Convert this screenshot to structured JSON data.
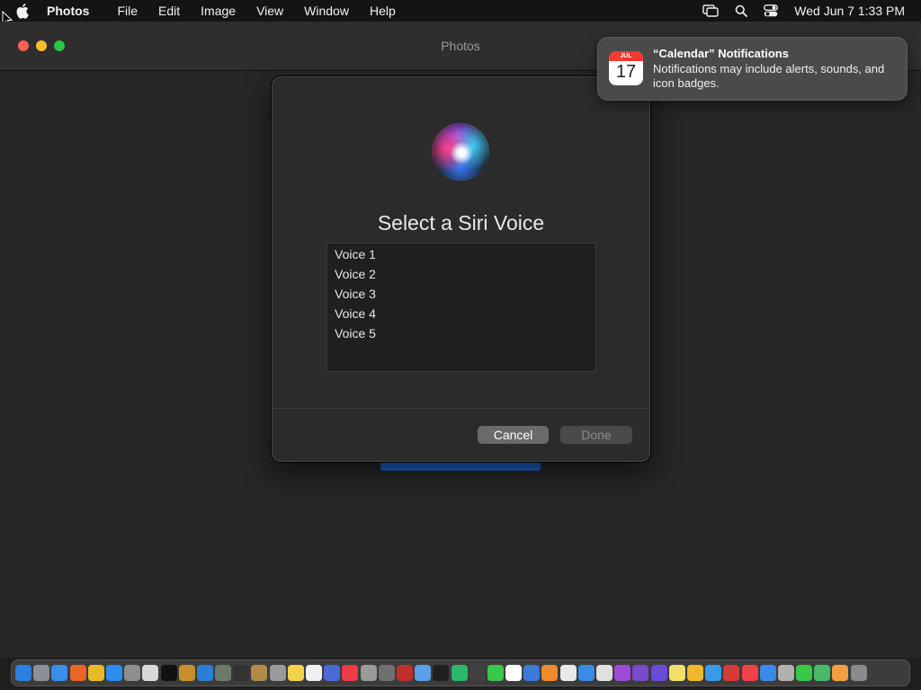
{
  "menubar": {
    "app_name": "Photos",
    "items": [
      "File",
      "Edit",
      "Image",
      "View",
      "Window",
      "Help"
    ],
    "clock": "Wed Jun 7  1:33 PM",
    "status_icons": [
      "screen-mirroring-icon",
      "search-icon",
      "control-center-icon"
    ]
  },
  "window": {
    "title": "Photos"
  },
  "dialog": {
    "title": "Select a Siri Voice",
    "voices": [
      "Voice 1",
      "Voice 2",
      "Voice 3",
      "Voice 4",
      "Voice 5"
    ],
    "cancel_label": "Cancel",
    "done_label": "Done"
  },
  "notification": {
    "title": "“Calendar” Notifications",
    "body": "Notifications may include alerts, sounds, and icon badges.",
    "calendar_month": "JUL",
    "calendar_day": "17"
  },
  "colors": {
    "accent_blue": "#1d5fc4",
    "close": "#ff5f57",
    "minimize": "#febc2e",
    "maximize": "#28c840"
  },
  "dock": {
    "icons": [
      {
        "name": "finder-icon",
        "color": "#2f7fe0"
      },
      {
        "name": "launchpad-icon",
        "color": "#8a8f98"
      },
      {
        "name": "safari-icon",
        "color": "#3a8ee8"
      },
      {
        "name": "firefox-icon",
        "color": "#e8662a"
      },
      {
        "name": "chrome-icon",
        "color": "#e8b92a"
      },
      {
        "name": "app-store-icon",
        "color": "#2c8cf0"
      },
      {
        "name": "system-settings-icon",
        "color": "#8e8e8e"
      },
      {
        "name": "script-editor-icon",
        "color": "#d8d8d8"
      },
      {
        "name": "terminal-icon",
        "color": "#111111"
      },
      {
        "name": "instruments-icon",
        "color": "#c8902a"
      },
      {
        "name": "vscode-icon",
        "color": "#2a7fd4"
      },
      {
        "name": "disk-utility-icon",
        "color": "#6a7a6a"
      },
      {
        "name": "stocks-icon",
        "color": "#333333"
      },
      {
        "name": "archive-icon",
        "color": "#b08a4a"
      },
      {
        "name": "screenshot-icon",
        "color": "#9a9a9a"
      },
      {
        "name": "notes-icon",
        "color": "#f2d34a"
      },
      {
        "name": "reminders-icon",
        "color": "#f0f0f0"
      },
      {
        "name": "xcode-icon",
        "color": "#4a6ad8"
      },
      {
        "name": "news-icon",
        "color": "#f03a4a"
      },
      {
        "name": "dictionary-icon",
        "color": "#9a9a9a"
      },
      {
        "name": "chess-icon",
        "color": "#707070"
      },
      {
        "name": "dictionary-book-icon",
        "color": "#c0302a"
      },
      {
        "name": "preview-icon",
        "color": "#5aa0e8"
      },
      {
        "name": "apple-tv-icon",
        "color": "#202020"
      },
      {
        "name": "find-my-icon",
        "color": "#2ab86a"
      },
      {
        "name": "voice-memos-icon",
        "color": "#404040"
      },
      {
        "name": "messages-icon",
        "color": "#3ac84a"
      },
      {
        "name": "calendar-icon",
        "color": "#ffffff"
      },
      {
        "name": "keynote-icon",
        "color": "#3a7ad8"
      },
      {
        "name": "books-icon",
        "color": "#f08a2a"
      },
      {
        "name": "textedit-icon",
        "color": "#e8e8e8"
      },
      {
        "name": "files-icon",
        "color": "#3a8ae8"
      },
      {
        "name": "clock-icon",
        "color": "#e0e0e0"
      },
      {
        "name": "podcasts-icon",
        "color": "#a04ad8"
      },
      {
        "name": "visual-studio-icon",
        "color": "#7a4ac8"
      },
      {
        "name": "accessibility-icon",
        "color": "#6a4ad8"
      },
      {
        "name": "stickies-icon",
        "color": "#f2e06a"
      },
      {
        "name": "home-icon",
        "color": "#f0b82a"
      },
      {
        "name": "quicktime-icon",
        "color": "#3a9ae8"
      },
      {
        "name": "photo-booth-icon",
        "color": "#d83a3a"
      },
      {
        "name": "music-icon",
        "color": "#f0404a"
      },
      {
        "name": "mail-icon",
        "color": "#3a8ae8"
      },
      {
        "name": "script-icon",
        "color": "#b0b0b0"
      },
      {
        "name": "facetime-icon",
        "color": "#3ac84a"
      },
      {
        "name": "maps-icon",
        "color": "#4ab86a"
      },
      {
        "name": "photos-icon",
        "color": "#f0a040"
      },
      {
        "name": "trash-icon",
        "color": "#8a8a8a"
      }
    ]
  }
}
